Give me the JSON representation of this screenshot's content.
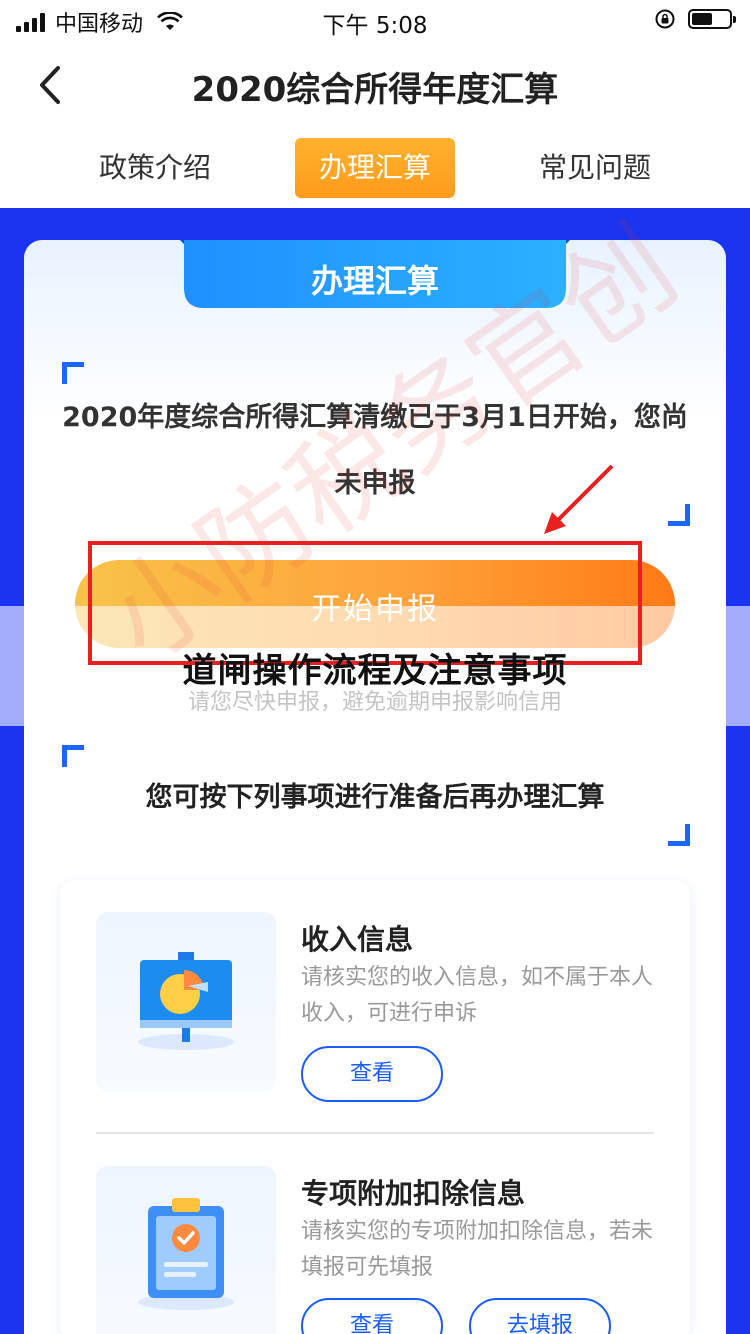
{
  "status_bar": {
    "carrier": "中国移动",
    "time": "下午 5:08"
  },
  "header": {
    "title": "2020综合所得年度汇算"
  },
  "tabs": [
    {
      "label": "政策介绍"
    },
    {
      "label": "办理汇算"
    },
    {
      "label": "常见问题"
    }
  ],
  "card": {
    "ribbon_label": "办理汇算",
    "notice": "2020年度综合所得汇算清缴已于3月1日开始，您尚未申报",
    "start_button": "开始申报",
    "hint": "请您尽快申报，避免逾期申报影响信用",
    "overlay_title": "道闸操作流程及注意事项",
    "prep_title": "您可按下列事项进行准备后再办理汇算"
  },
  "watermark": "小防税务官创",
  "items": [
    {
      "title": "收入信息",
      "desc": "请核实您的收入信息，如不属于本人收入，可进行申诉",
      "view_label": "查看"
    },
    {
      "title": "专项附加扣除信息",
      "desc": "请核实您的专项附加扣除信息，若未填报可先填报",
      "view_label": "查看",
      "fill_label": "去填报"
    }
  ],
  "colors": {
    "accent_blue": "#1a34f0",
    "tab_active": "#ff9b1c",
    "button_gradient_end": "#ff7a16",
    "highlight_red": "#e82020"
  }
}
